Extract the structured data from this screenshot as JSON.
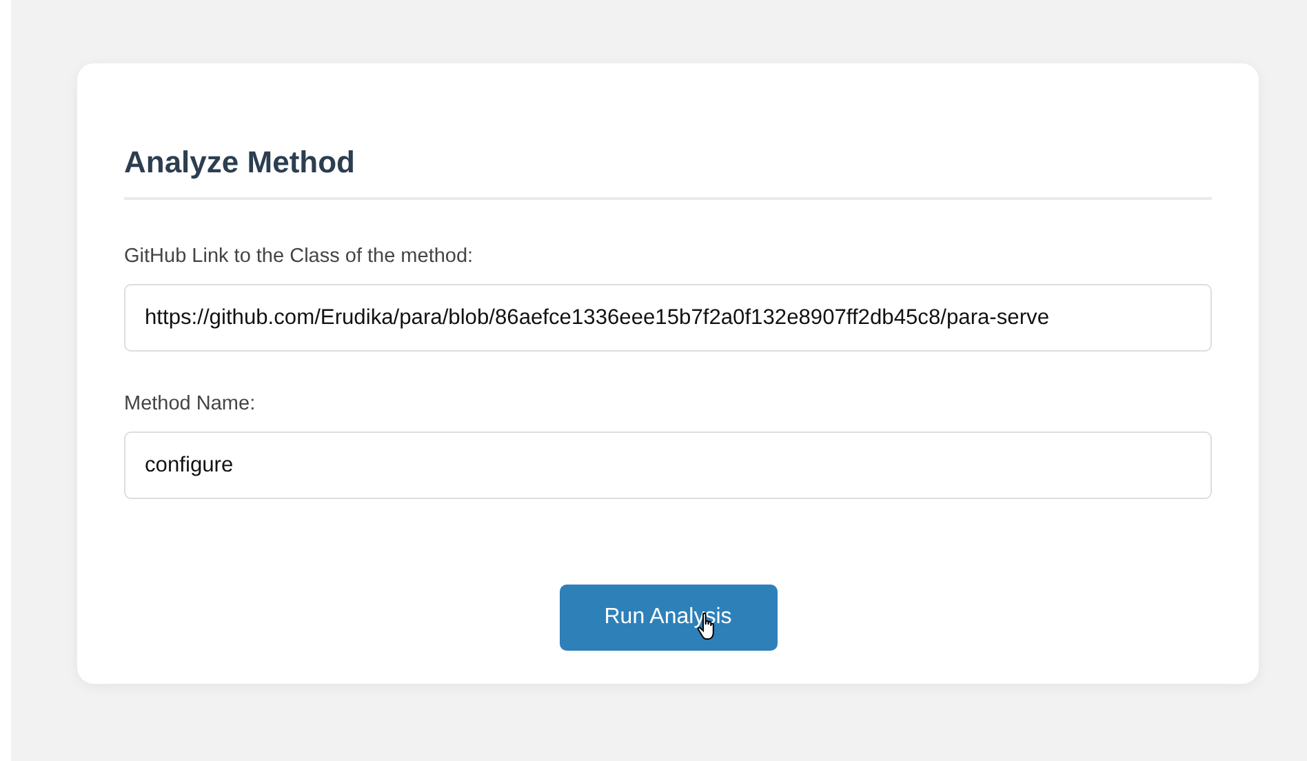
{
  "card": {
    "title": "Analyze Method",
    "fields": [
      {
        "label": "GitHub Link to the Class of the method:",
        "value": "https://github.com/Erudika/para/blob/86aefce1336eee15b7f2a0f132e8907ff2db45c8/para-serve"
      },
      {
        "label": "Method Name:",
        "value": "configure"
      }
    ],
    "button": "Run Analysis"
  }
}
